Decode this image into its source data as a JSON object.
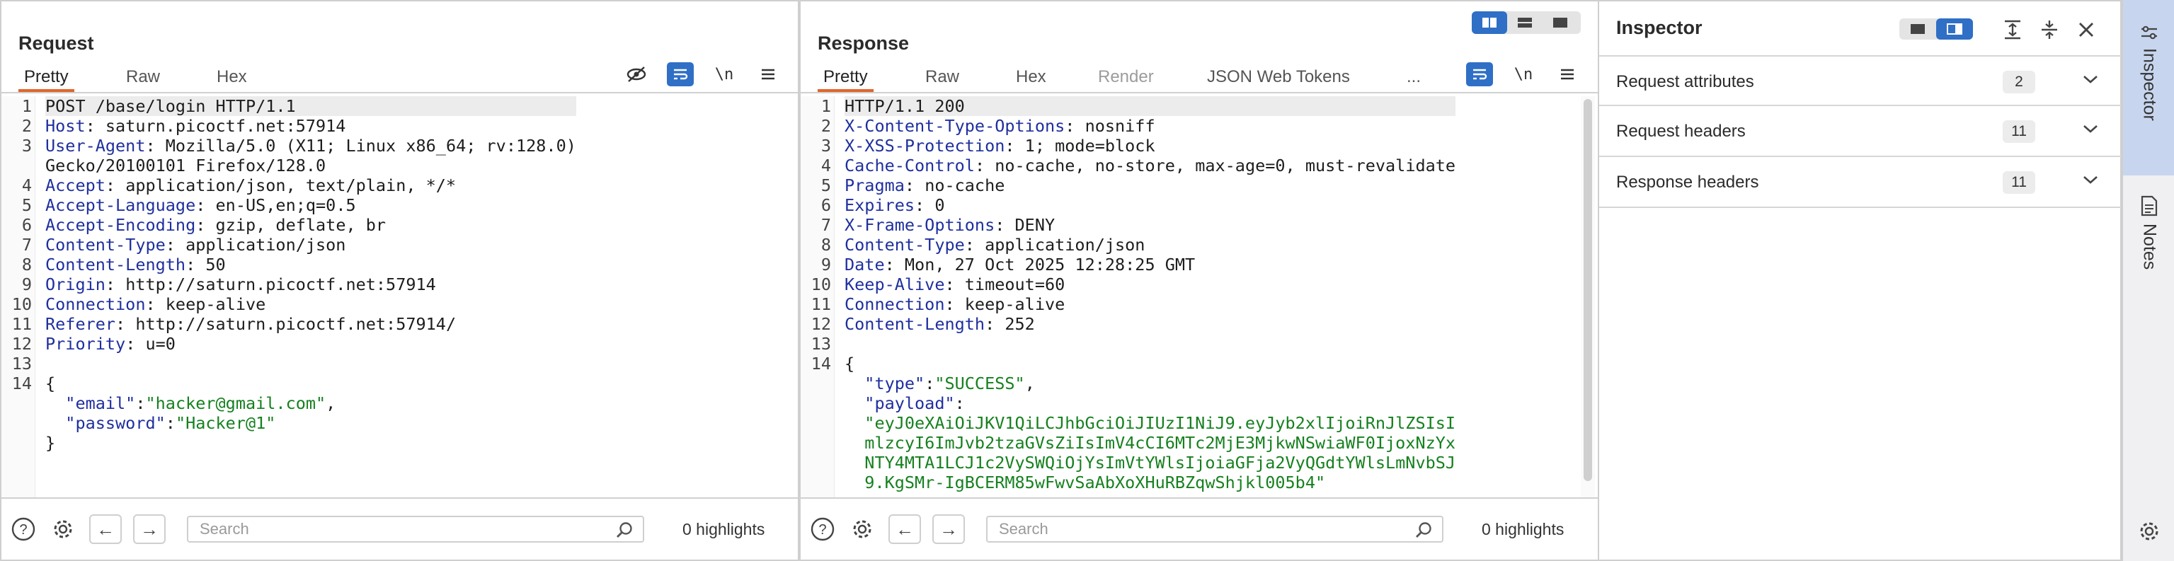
{
  "view_toggle": {
    "selected": "side-by-side"
  },
  "request": {
    "title": "Request",
    "tabs": [
      {
        "label": "Pretty",
        "active": true
      },
      {
        "label": "Raw",
        "active": false
      },
      {
        "label": "Hex",
        "active": false
      }
    ],
    "line_numbers": [
      "1",
      "2",
      "3",
      "",
      "4",
      "5",
      "6",
      "7",
      "8",
      "9",
      "10",
      "11",
      "12",
      "13",
      "14",
      "",
      "",
      ""
    ],
    "lines": [
      {
        "name": "",
        "value": "POST /base/login HTTP/1.1"
      },
      {
        "name": "Host",
        "value": " saturn.picoctf.net:57914"
      },
      {
        "name": "User-Agent",
        "value": " Mozilla/5.0 (X11; Linux x86_64; rv:128.0)"
      },
      {
        "name": "",
        "value": "Gecko/20100101 Firefox/128.0"
      },
      {
        "name": "Accept",
        "value": " application/json, text/plain, */*"
      },
      {
        "name": "Accept-Language",
        "value": " en-US,en;q=0.5"
      },
      {
        "name": "Accept-Encoding",
        "value": " gzip, deflate, br"
      },
      {
        "name": "Content-Type",
        "value": " application/json"
      },
      {
        "name": "Content-Length",
        "value": " 50"
      },
      {
        "name": "Origin",
        "value": " http://saturn.picoctf.net:57914"
      },
      {
        "name": "Connection",
        "value": " keep-alive"
      },
      {
        "name": "Referer",
        "value": " http://saturn.picoctf.net:57914/"
      },
      {
        "name": "Priority",
        "value": " u=0"
      },
      {
        "name": "",
        "value": ""
      },
      {
        "name": "",
        "value": "{"
      }
    ],
    "body": [
      {
        "key": "\"email\"",
        "sep": ":",
        "val": "\"hacker@gmail.com\"",
        "tail": ","
      },
      {
        "key": "\"password\"",
        "sep": ":",
        "val": "\"Hacker@1\"",
        "tail": ""
      }
    ],
    "body_close": "}",
    "search_placeholder": "Search",
    "highlights": "0 highlights"
  },
  "response": {
    "title": "Response",
    "tabs": [
      {
        "label": "Pretty",
        "active": true
      },
      {
        "label": "Raw",
        "active": false
      },
      {
        "label": "Hex",
        "active": false
      },
      {
        "label": "Render",
        "active": false,
        "disabled": true
      },
      {
        "label": "JSON Web Tokens",
        "active": false
      },
      {
        "label": "...",
        "active": false
      }
    ],
    "line_numbers": [
      "1",
      "2",
      "3",
      "4",
      "5",
      "6",
      "7",
      "8",
      "9",
      "10",
      "11",
      "12",
      "13",
      "14",
      "",
      "",
      "",
      "",
      "",
      "",
      ""
    ],
    "lines": [
      {
        "name": "",
        "value": "HTTP/1.1 200"
      },
      {
        "name": "X-Content-Type-Options",
        "value": " nosniff"
      },
      {
        "name": "X-XSS-Protection",
        "value": " 1; mode=block"
      },
      {
        "name": "Cache-Control",
        "value": " no-cache, no-store, max-age=0, must-revalidate"
      },
      {
        "name": "Pragma",
        "value": " no-cache"
      },
      {
        "name": "Expires",
        "value": " 0"
      },
      {
        "name": "X-Frame-Options",
        "value": " DENY"
      },
      {
        "name": "Content-Type",
        "value": " application/json"
      },
      {
        "name": "Date",
        "value": " Mon, 27 Oct 2025 12:28:25 GMT"
      },
      {
        "name": "Keep-Alive",
        "value": " timeout=60"
      },
      {
        "name": "Connection",
        "value": " keep-alive"
      },
      {
        "name": "Content-Length",
        "value": " 252"
      },
      {
        "name": "",
        "value": ""
      },
      {
        "name": "",
        "value": "{"
      }
    ],
    "body_type_key": "\"type\"",
    "body_type_val": "\"SUCCESS\"",
    "body_payload_key": "\"payload\"",
    "payload_lines": [
      "\"eyJ0eXAiOiJKV1QiLCJhbGciOiJIUzI1NiJ9.eyJyb2xlIjoiRnJlZSIsI",
      "mlzcyI6ImJvb2tzaGVsZiIsImV4cCI6MTc2MjE3MjkwNSwiaWF0IjoxNzYx",
      "NTY4MTA1LCJ1c2VySWQiOjYsImVtYWlsIjoiaGFja2VyQGdtYWlsLmNvbSJ",
      "9.KgSMr-IgBCERM85wFwvSaAbXoXHuRBZqwShjkl005b4\""
    ],
    "search_placeholder": "Search",
    "highlights": "0 highlights"
  },
  "inspector": {
    "title": "Inspector",
    "sections": [
      {
        "label": "Request attributes",
        "count": "2"
      },
      {
        "label": "Request headers",
        "count": "11"
      },
      {
        "label": "Response headers",
        "count": "11"
      }
    ]
  },
  "rail": {
    "items": [
      {
        "label": "Inspector",
        "active": true
      },
      {
        "label": "Notes",
        "active": false
      }
    ]
  },
  "colors": {
    "accent": "#e0662a",
    "blue": "#2f6fc6",
    "header_name": "#1f2f9e",
    "json_string": "#16801f"
  }
}
